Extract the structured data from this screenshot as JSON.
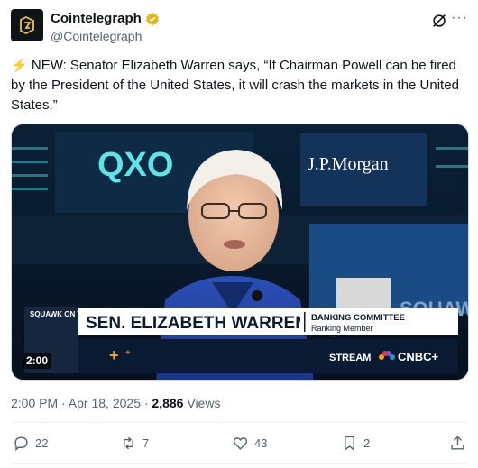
{
  "account": {
    "display_name": "Cointelegraph",
    "handle": "@Cointelegraph"
  },
  "tweet": {
    "emoji": "⚡",
    "text": " NEW: Senator Elizabeth Warren says, “If Chairman Powell can be fired by the President of the United States, it will crash the markets in the United States.”"
  },
  "video": {
    "duration": "2:00",
    "banner_left": "SQUAWK ON THE STREET",
    "banner_name": "SEN. ELIZABETH WARREN",
    "banner_title": "BANKING COMMITTEE",
    "banner_subtitle": "Ranking Member",
    "ticker_logo": "QXO",
    "bank_logo": "J.P.Morgan",
    "stream_label": "STREAM",
    "network": "CNBC+",
    "side_logo": "SQUAW"
  },
  "meta": {
    "time": "2:00 PM · Apr 18, 2025 · ",
    "views_count": "2,886",
    "views_label": " Views"
  },
  "actions": {
    "replies": "22",
    "reposts": "7",
    "likes": "43",
    "bookmarks": "2"
  },
  "colors": {
    "accent": "#1d9bf0",
    "verified": "#e2b719",
    "text_secondary": "#536471"
  }
}
